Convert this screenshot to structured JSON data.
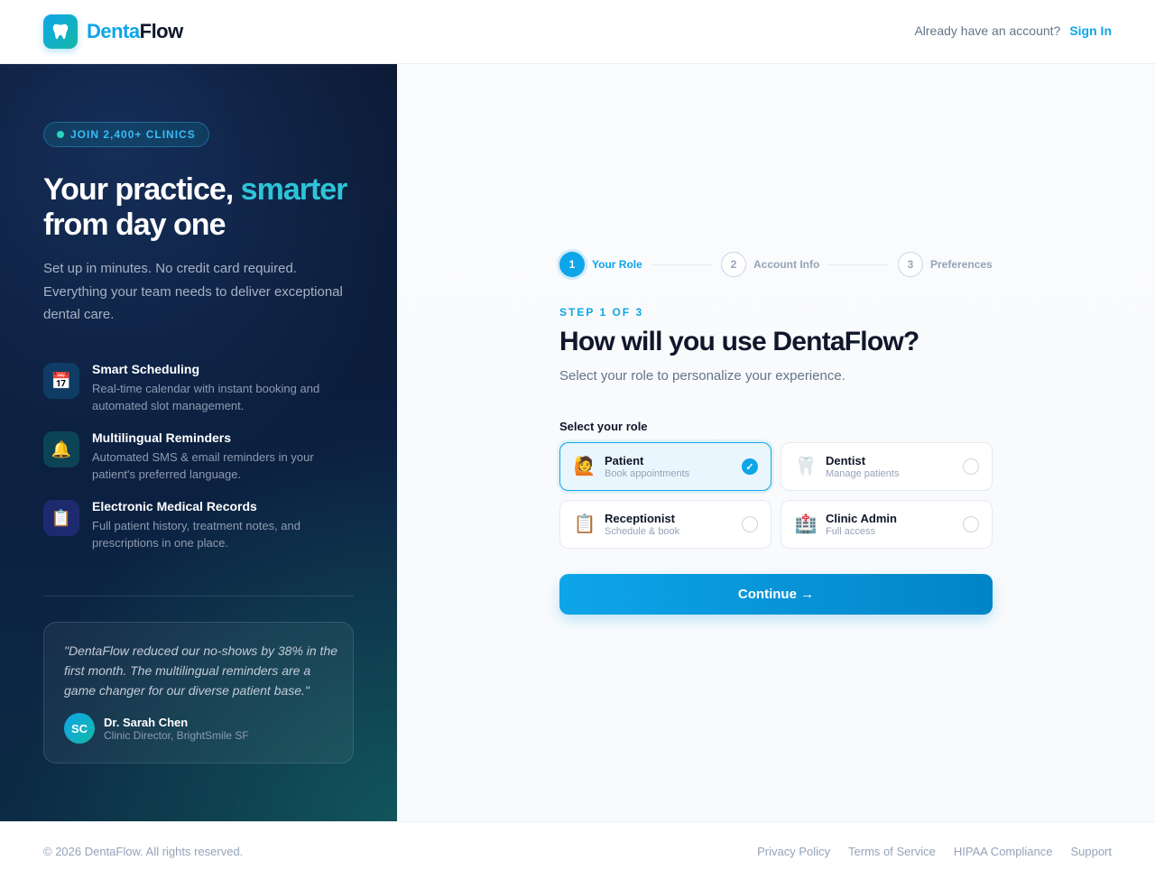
{
  "header": {
    "brand_part1": "Denta",
    "brand_part2": "Flow",
    "account_prompt": "Already have an account?",
    "signin_label": "Sign In"
  },
  "left": {
    "badge": "JOIN 2,400+ CLINICS",
    "hero_line1_a": "Your practice, ",
    "hero_line1_b": "smarter",
    "hero_line2": "from day one",
    "subtitle": "Set up in minutes. No credit card required. Everything your team needs to deliver exceptional dental care.",
    "features": [
      {
        "icon": "calendar-icon",
        "glyph": "📅",
        "title": "Smart Scheduling",
        "desc": "Real-time calendar with instant booking and automated slot management."
      },
      {
        "icon": "bell-icon",
        "glyph": "🔔",
        "title": "Multilingual Reminders",
        "desc": "Automated SMS & email reminders in your patient's preferred language."
      },
      {
        "icon": "clipboard-icon",
        "glyph": "📋",
        "title": "Electronic Medical Records",
        "desc": "Full patient history, treatment notes, and prescriptions in one place."
      }
    ],
    "testimonial": {
      "quote": "\"DentaFlow reduced our no-shows by 38% in the first month. The multilingual reminders are a game changer for our diverse patient base.\"",
      "initials": "SC",
      "name": "Dr. Sarah Chen",
      "role": "Clinic Director, BrightSmile SF"
    }
  },
  "stepper": {
    "steps": [
      {
        "number": "1",
        "label": "Your Role",
        "state": "active"
      },
      {
        "number": "2",
        "label": "Account Info",
        "state": "idle"
      },
      {
        "number": "3",
        "label": "Preferences",
        "state": "idle"
      }
    ]
  },
  "form": {
    "step_of": "STEP 1 OF 3",
    "title": "How will you use DentaFlow?",
    "description": "Select your role to personalize your experience.",
    "role_label": "Select your role",
    "roles": [
      {
        "icon": "raising-hand-icon",
        "glyph": "🙋",
        "name": "Patient",
        "sub": "Book appointments",
        "selected": true
      },
      {
        "icon": "tooth-icon",
        "glyph": "🦷",
        "name": "Dentist",
        "sub": "Manage patients",
        "selected": false
      },
      {
        "icon": "clipboard-icon",
        "glyph": "📋",
        "name": "Receptionist",
        "sub": "Schedule & book",
        "selected": false
      },
      {
        "icon": "hospital-icon",
        "glyph": "🏥",
        "name": "Clinic Admin",
        "sub": "Full access",
        "selected": false
      }
    ],
    "check_glyph": "✓",
    "continue_label": "Continue →"
  },
  "footer": {
    "copyright": "© 2026 DentaFlow. All rights reserved.",
    "links": [
      "Privacy Policy",
      "Terms of Service",
      "HIPAA Compliance",
      "Support"
    ]
  },
  "colors": {
    "accent": "#0ea5e9",
    "teal": "#14b8a6",
    "dark_panel": "#0c2142"
  }
}
